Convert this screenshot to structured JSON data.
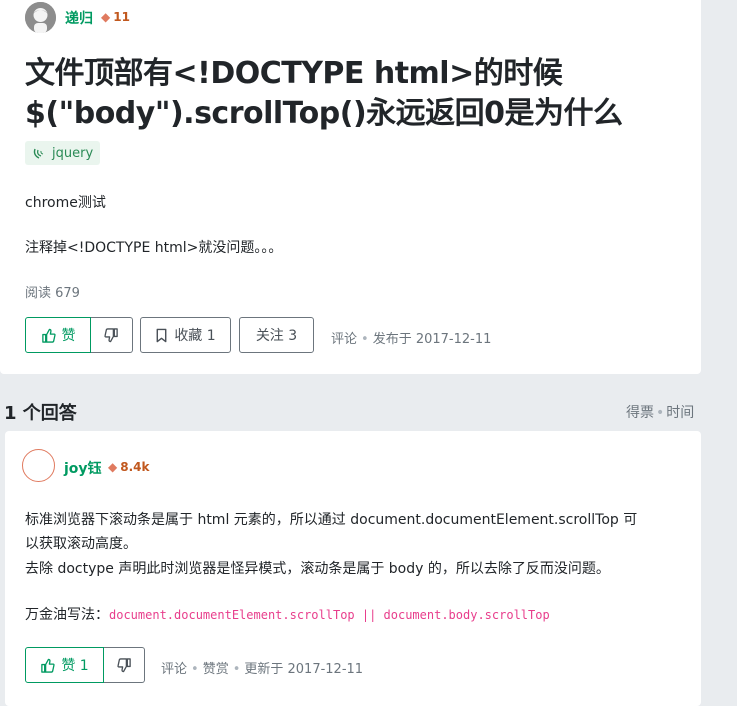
{
  "question": {
    "user": {
      "name": "递归",
      "reputation": "11"
    },
    "title_line1": "文件顶部有<!DOCTYPE html>的时候",
    "title_line2": "$(\"body\").scrollTop()永远返回0是为什么",
    "tag": "jquery",
    "body_line1": "chrome测试",
    "body_line2": "注释掉<!DOCTYPE html>就没问题。。。",
    "read_count": "阅读 679",
    "upvote_label": "赞",
    "bookmark_label": "收藏 1",
    "follow_label": "关注 3",
    "comment_link": "评论",
    "published": "发布于 2017-12-11"
  },
  "answers_heading": "1 个回答",
  "sort": {
    "votes": "得票",
    "time": "时间"
  },
  "answer": {
    "user": {
      "name": "joy钰",
      "reputation": "8.4k"
    },
    "para1_line1": "标准浏览器下滚动条是属于 html 元素的，所以通过 document.documentElement.scrollTop 可",
    "para1_line2": "以获取滚动高度。",
    "para2": "去除 doctype 声明此时浏览器是怪异模式，滚动条是属于 body 的，所以去除了反而没问题。",
    "formula_label": "万金油写法：",
    "formula_code": "document.documentElement.scrollTop || document.body.scrollTop",
    "upvote_label": "赞 1",
    "comment_link": "评论",
    "reward_link": "赞赏",
    "updated": "更新于 2017-12-11"
  },
  "colors": {
    "brand_green": "#009a61",
    "reputation": "#c1581e",
    "code": "#e83e8c"
  }
}
